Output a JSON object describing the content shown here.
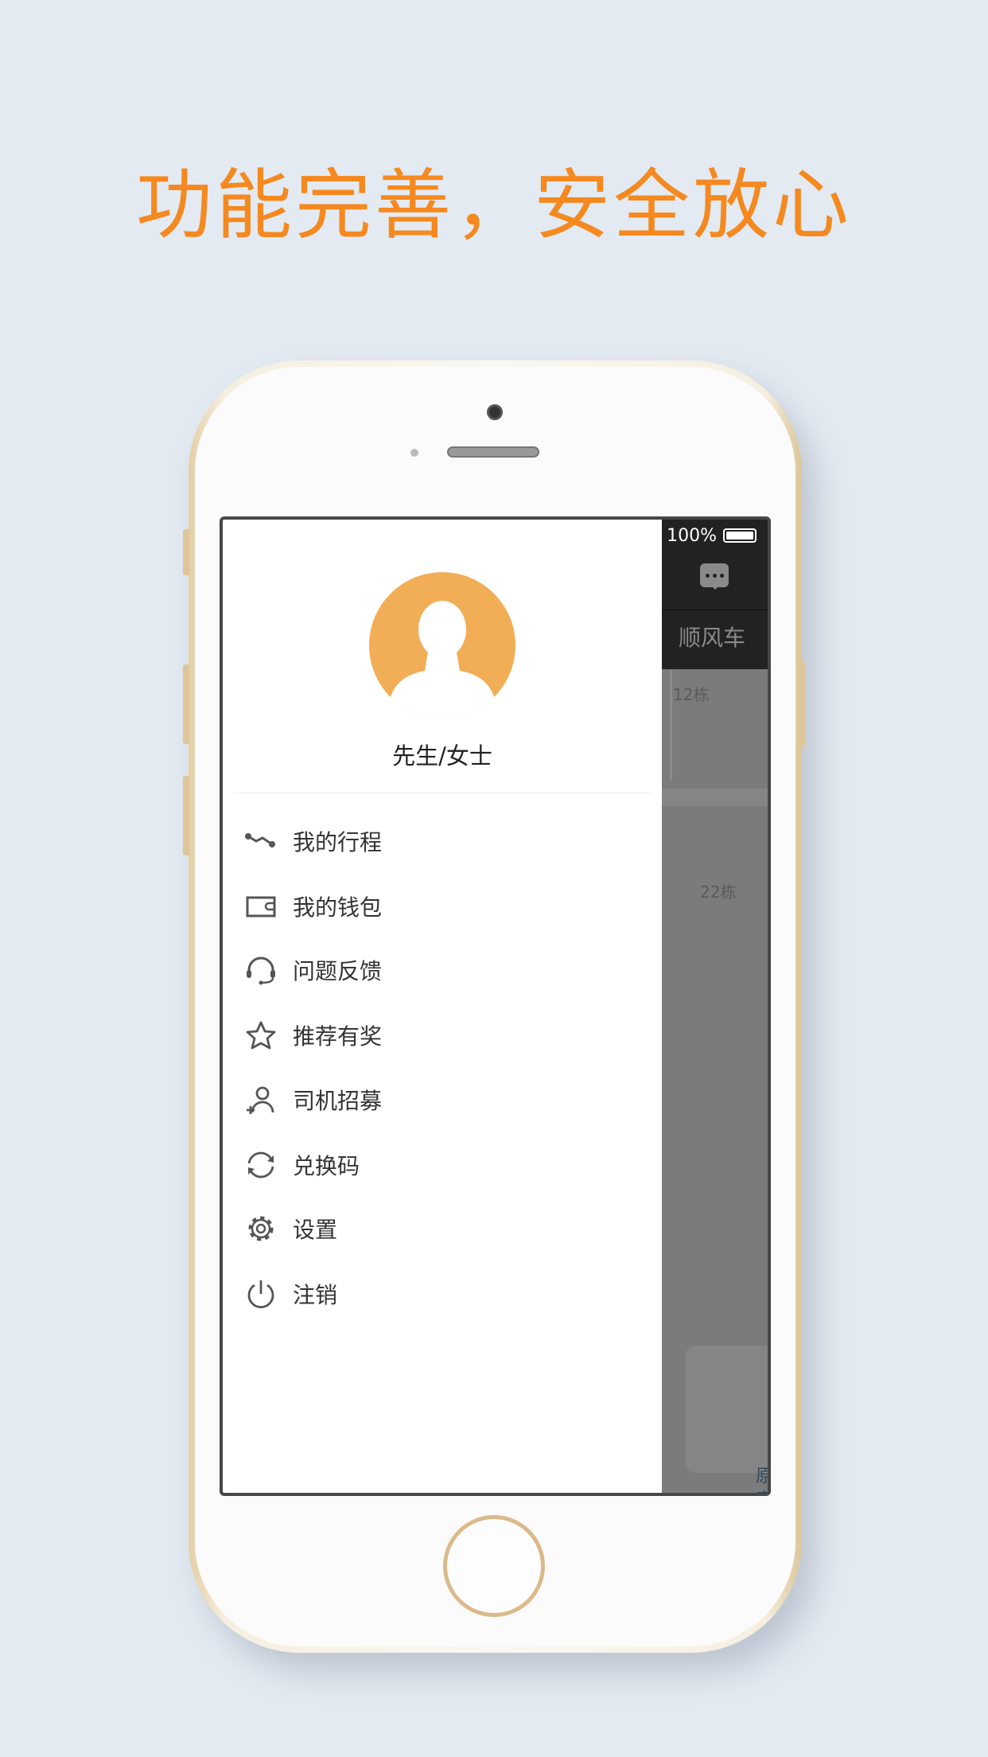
{
  "headline": "功能完善，安全放心",
  "colors": {
    "headline": "#f5891f",
    "avatar": "#f2ae56",
    "appbar": "#222222",
    "map": "#7b7b7b"
  },
  "status_bar": {
    "battery_text": "100%",
    "battery_level": 1.0,
    "icons": [
      "bluetooth-icon",
      "battery-icon"
    ]
  },
  "app": {
    "tab": "顺风车",
    "map_labels": [
      "12栋",
      "22栋",
      "原寓"
    ]
  },
  "drawer": {
    "user_name": "先生/女士",
    "menu": [
      {
        "label": "我的行程",
        "icon": "route-icon"
      },
      {
        "label": "我的钱包",
        "icon": "wallet-icon"
      },
      {
        "label": "问题反馈",
        "icon": "headset-icon"
      },
      {
        "label": "推荐有奖",
        "icon": "star-icon"
      },
      {
        "label": "司机招募",
        "icon": "add-user-icon"
      },
      {
        "label": "兑换码",
        "icon": "refresh-icon"
      },
      {
        "label": "设置",
        "icon": "gear-icon"
      },
      {
        "label": "注销",
        "icon": "power-icon"
      }
    ]
  }
}
